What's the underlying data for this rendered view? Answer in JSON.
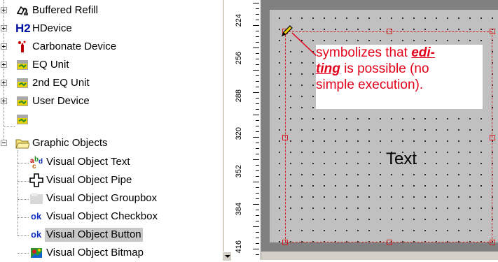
{
  "tree": {
    "items": [
      {
        "label": "Buffered Refill",
        "icon": "refill-icon"
      },
      {
        "label": "HDevice",
        "icon": "h2-icon",
        "icon_text": "H2"
      },
      {
        "label": "Carbonate Device",
        "icon": "carbonate-icon"
      },
      {
        "label": "EQ Unit",
        "icon": "eq-unit-icon"
      },
      {
        "label": "2nd EQ Unit",
        "icon": "eq-unit-icon"
      },
      {
        "label": "User Device",
        "icon": "eq-unit-icon"
      },
      {
        "label": "",
        "icon": "eq-unit-icon"
      },
      {
        "label": "Graphic Objects",
        "icon": "folder-open-icon"
      }
    ],
    "children": [
      {
        "label": "Visual Object Text",
        "icon": "abc-text-icon"
      },
      {
        "label": "Visual Object Pipe",
        "icon": "pipe-cross-icon"
      },
      {
        "label": "Visual Object Groupbox",
        "icon": "groupbox-icon"
      },
      {
        "label": "Visual Object Checkbox",
        "icon": "ok-checkbox-icon",
        "icon_text": "ok"
      },
      {
        "label": "Visual Object Button",
        "icon": "ok-button-icon",
        "icon_text": "ok",
        "selected": true
      },
      {
        "label": "Visual Object Bitmap",
        "icon": "bitmap-icon"
      }
    ]
  },
  "ruler": {
    "labels": [
      "224",
      "256",
      "288",
      "320",
      "352",
      "384",
      "416"
    ]
  },
  "canvas": {
    "object_text": "Text"
  },
  "annotation": {
    "line1": "symbolizes that ",
    "line1_em": "edi-",
    "line2_em": "ting",
    "line2": " is possible (no",
    "line3": "simple execution)."
  },
  "colors": {
    "annotation": "#e2001a",
    "selection": "#c8c8c8",
    "canvas": "#c0c0c0",
    "handles": "#d0202a"
  }
}
